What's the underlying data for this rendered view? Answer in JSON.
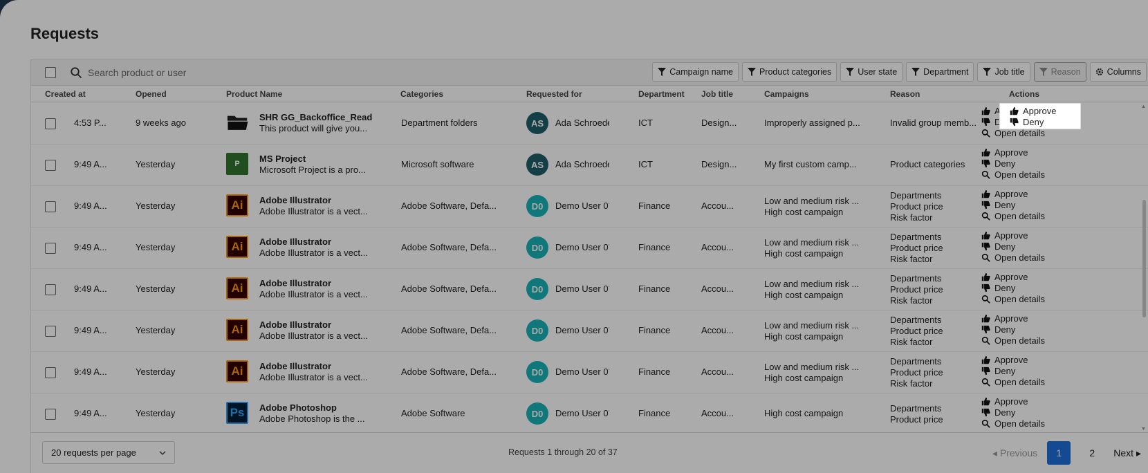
{
  "page": {
    "title": "Requests"
  },
  "toolbar": {
    "search_placeholder": "Search product or user",
    "filters": [
      "Campaign name",
      "Product categories",
      "User state",
      "Department",
      "Job title",
      "Reason"
    ],
    "columns_label": "Columns"
  },
  "table": {
    "headers": [
      "Created at",
      "Opened",
      "Product Name",
      "Categories",
      "Requested for",
      "Department",
      "Job title",
      "Campaigns",
      "Reason",
      "Actions"
    ],
    "actions": {
      "approve": "Approve",
      "deny": "Deny",
      "details": "Open details"
    },
    "rows": [
      {
        "created": "4:53 P...",
        "opened": "9 weeks ago",
        "icon": "folder-icon",
        "name": "SHR GG_Backoffice_Read",
        "desc": "This product will give you...",
        "categories": "Department folders",
        "avatar": "AS",
        "user": "Ada Schroede",
        "department": "ICT",
        "job": "Design...",
        "campaigns": [
          "Improperly assigned p..."
        ],
        "reason": [
          "Invalid group memb..."
        ]
      },
      {
        "created": "9:49 A...",
        "opened": "Yesterday",
        "icon": "ms-project-icon",
        "name": "MS Project",
        "desc": "Microsoft Project is a pro...",
        "categories": "Microsoft software",
        "avatar": "AS",
        "user": "Ada Schroede",
        "department": "ICT",
        "job": "Design...",
        "campaigns": [
          "My first custom camp..."
        ],
        "reason": [
          "Product categories"
        ]
      },
      {
        "created": "9:49 A...",
        "opened": "Yesterday",
        "icon": "adobe-illustrator-icon",
        "name": "Adobe Illustrator",
        "desc": "Adobe Illustrator is a vect...",
        "categories": "Adobe Software, Defa...",
        "avatar": "D0",
        "user": "Demo User 0´",
        "department": "Finance",
        "job": "Accou...",
        "campaigns": [
          "Low and medium risk ...",
          "High cost campaign"
        ],
        "reason": [
          "Departments",
          "Product price",
          "Risk factor"
        ]
      },
      {
        "created": "9:49 A...",
        "opened": "Yesterday",
        "icon": "adobe-illustrator-icon",
        "name": "Adobe Illustrator",
        "desc": "Adobe Illustrator is a vect...",
        "categories": "Adobe Software, Defa...",
        "avatar": "D0",
        "user": "Demo User 0´",
        "department": "Finance",
        "job": "Accou...",
        "campaigns": [
          "Low and medium risk ...",
          "High cost campaign"
        ],
        "reason": [
          "Departments",
          "Product price",
          "Risk factor"
        ]
      },
      {
        "created": "9:49 A...",
        "opened": "Yesterday",
        "icon": "adobe-illustrator-icon",
        "name": "Adobe Illustrator",
        "desc": "Adobe Illustrator is a vect...",
        "categories": "Adobe Software, Defa...",
        "avatar": "D0",
        "user": "Demo User 0´",
        "department": "Finance",
        "job": "Accou...",
        "campaigns": [
          "Low and medium risk ...",
          "High cost campaign"
        ],
        "reason": [
          "Departments",
          "Product price",
          "Risk factor"
        ]
      },
      {
        "created": "9:49 A...",
        "opened": "Yesterday",
        "icon": "adobe-illustrator-icon",
        "name": "Adobe Illustrator",
        "desc": "Adobe Illustrator is a vect...",
        "categories": "Adobe Software, Defa...",
        "avatar": "D0",
        "user": "Demo User 0´",
        "department": "Finance",
        "job": "Accou...",
        "campaigns": [
          "Low and medium risk ...",
          "High cost campaign"
        ],
        "reason": [
          "Departments",
          "Product price",
          "Risk factor"
        ]
      },
      {
        "created": "9:49 A...",
        "opened": "Yesterday",
        "icon": "adobe-illustrator-icon",
        "name": "Adobe Illustrator",
        "desc": "Adobe Illustrator is a vect...",
        "categories": "Adobe Software, Defa...",
        "avatar": "D0",
        "user": "Demo User 0´",
        "department": "Finance",
        "job": "Accou...",
        "campaigns": [
          "Low and medium risk ...",
          "High cost campaign"
        ],
        "reason": [
          "Departments",
          "Product price",
          "Risk factor"
        ]
      },
      {
        "created": "9:49 A...",
        "opened": "Yesterday",
        "icon": "adobe-photoshop-icon",
        "name": "Adobe Photoshop",
        "desc": "Adobe Photoshop is the ...",
        "categories": "Adobe Software",
        "avatar": "D0",
        "user": "Demo User 0´",
        "department": "Finance",
        "job": "Accou...",
        "campaigns": [
          "High cost campaign"
        ],
        "reason": [
          "Departments",
          "Product price"
        ]
      }
    ]
  },
  "footer": {
    "per_page": "20 requests per page",
    "count_text": "Requests 1 through 20 of 37",
    "previous": "Previous",
    "pages": [
      "1",
      "2"
    ],
    "next": "Next"
  },
  "colors": {
    "accent": "#1d6fd9",
    "avatar_as": "#1f5f6b",
    "avatar_d0": "#19b3b8"
  }
}
